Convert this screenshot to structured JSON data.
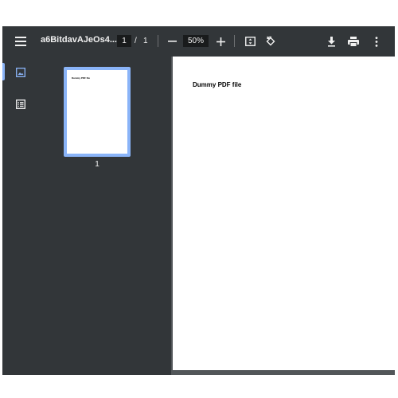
{
  "toolbar": {
    "menu_icon": "menu-icon",
    "title": "a6BitdavAJeOs4...",
    "page_current": "1",
    "page_separator": "/",
    "page_total": "1",
    "zoom_out_icon": "minus-icon",
    "zoom_value": "50%",
    "zoom_in_icon": "plus-icon",
    "fit_icon": "fit-to-page-icon",
    "rotate_icon": "rotate-icon",
    "download_icon": "download-icon",
    "print_icon": "print-icon",
    "more_icon": "more-vert-icon"
  },
  "sidebar": {
    "thumbnails_icon": "image-icon",
    "outline_icon": "list-icon",
    "thumbnail": {
      "page_text": "Dummy PDF file",
      "page_number": "1"
    }
  },
  "document": {
    "page_text": "Dummy PDF file"
  },
  "colors": {
    "toolbar_bg": "#323639",
    "canvas_bg": "#525659",
    "accent": "#8ab4f8",
    "text": "#f1f1f1"
  }
}
